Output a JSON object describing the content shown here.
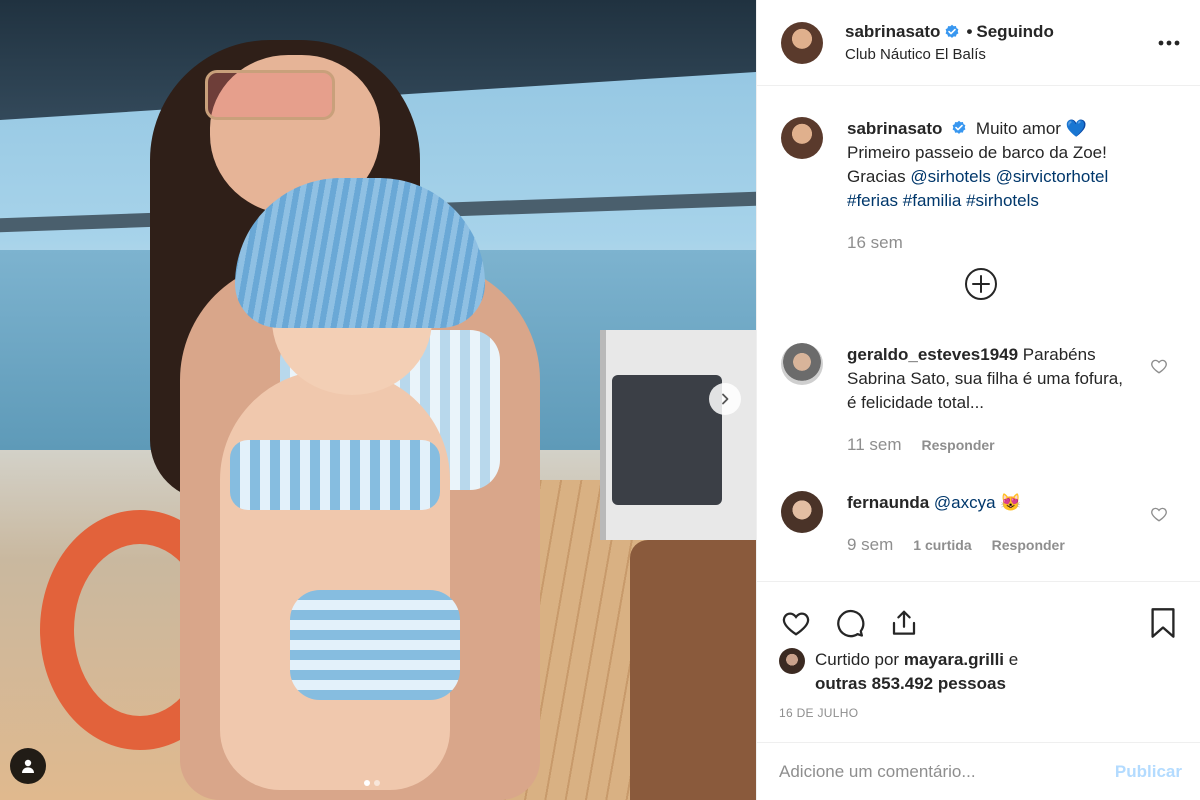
{
  "header": {
    "username": "sabrinasato",
    "separator": "•",
    "follow_status": "Seguindo",
    "location": "Club Náutico El Balís"
  },
  "caption": {
    "username": "sabrinasato",
    "text_line1": "Muito amor",
    "emoji": "💙",
    "text_line2": "Primeiro passeio de barco da Zoe!",
    "text_prefix": "Gracias",
    "mention1": "@sirhotels",
    "mention2": "@sirvictorhotel",
    "hashtags": [
      "#ferias",
      "#familia",
      "#sirhotels"
    ],
    "time": "16 sem"
  },
  "comments": [
    {
      "username": "geraldo_esteves1949",
      "text": "Parabéns Sabrina Sato, sua filha é uma fofura, é felicidade total...",
      "time": "11 sem",
      "reply_label": "Responder"
    },
    {
      "username": "fernaunda",
      "mention": "@axcya",
      "emoji": "😻",
      "time": "9 sem",
      "likes_label": "1 curtida",
      "reply_label": "Responder"
    }
  ],
  "likes": {
    "prefix": "Curtido por",
    "user": "mayara.grilli",
    "conj": "e",
    "others": "outras 853.492 pessoas"
  },
  "post_date": "16 DE JULHO",
  "add_comment": {
    "placeholder": "Adicione um comentário...",
    "publish_label": "Publicar"
  },
  "colors": {
    "link": "#00376b",
    "verified": "#3897f0",
    "muted": "#8e8e8e",
    "publish_disabled": "#b3dbff"
  },
  "carousel": {
    "total_slides": 2,
    "active_slide": 1
  }
}
